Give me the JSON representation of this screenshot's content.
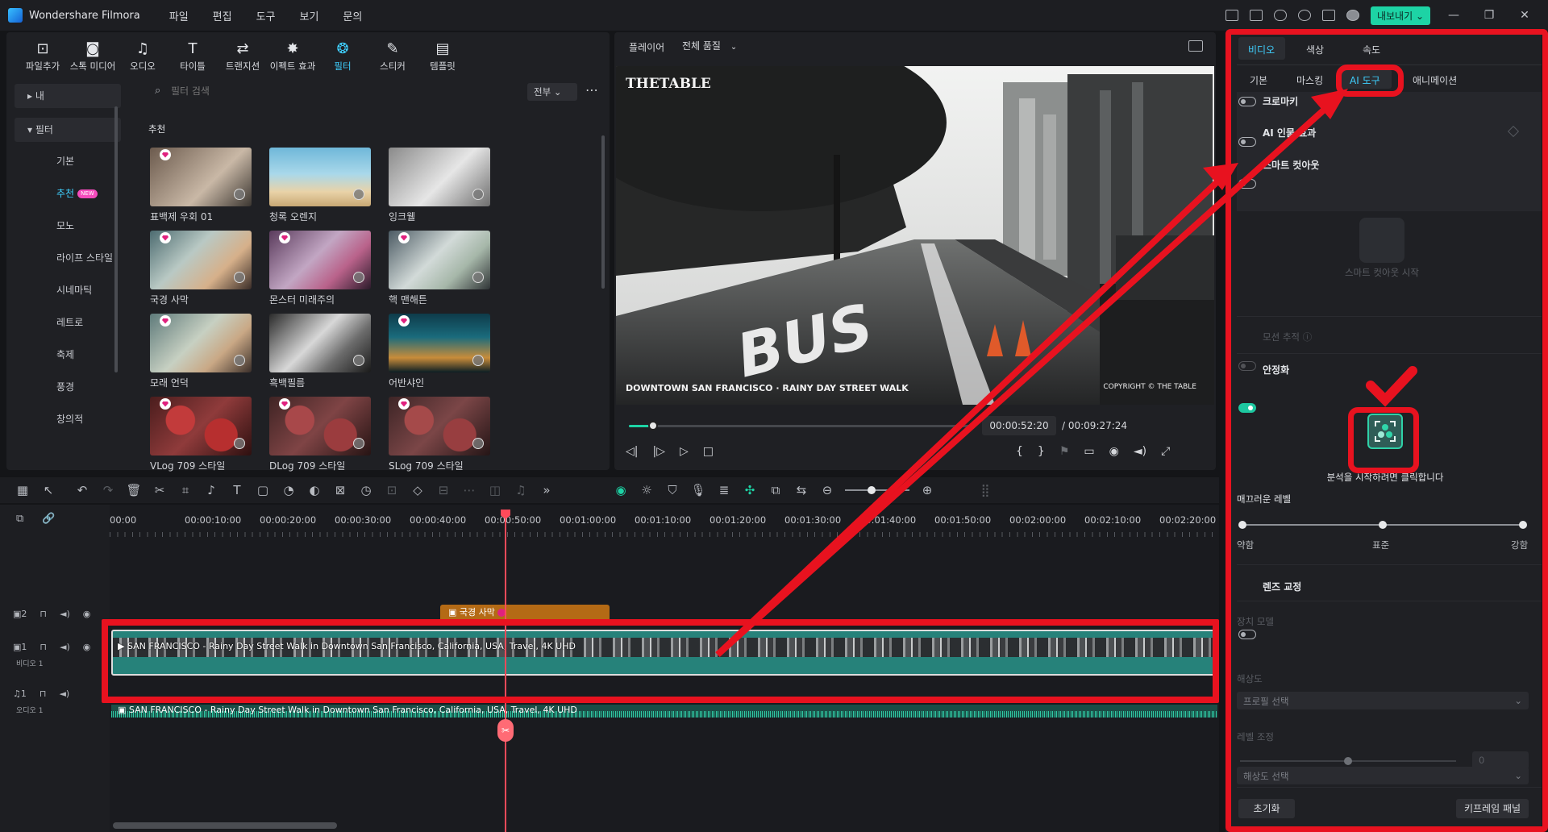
{
  "app": {
    "title": "Wondershare Filmora",
    "menu": [
      "파일",
      "편집",
      "도구",
      "보기",
      "문의"
    ],
    "export": "내보내기"
  },
  "toolbar": {
    "tools": [
      {
        "icon": "import-icon",
        "label": "파일추가",
        "glyph": "⊡"
      },
      {
        "icon": "stock-media-icon",
        "label": "스톡 미디어",
        "glyph": "◙"
      },
      {
        "icon": "audio-icon",
        "label": "오디오",
        "glyph": "♫"
      },
      {
        "icon": "title-icon",
        "label": "타이틀",
        "glyph": "T"
      },
      {
        "icon": "transition-icon",
        "label": "트랜지션",
        "glyph": "⇄"
      },
      {
        "icon": "effects-icon",
        "label": "이펙트 효과",
        "glyph": "✸"
      },
      {
        "icon": "filter-icon",
        "label": "필터",
        "glyph": "❂"
      },
      {
        "icon": "sticker-icon",
        "label": "스티커",
        "glyph": "✎"
      },
      {
        "icon": "template-icon",
        "label": "템플릿",
        "glyph": "▤"
      }
    ]
  },
  "sidebar": {
    "my": "내",
    "filter": "필터",
    "items": [
      "기본",
      "추천",
      "모노",
      "라이프 스타일",
      "시네마틱",
      "레트로",
      "축제",
      "풍경",
      "창의적"
    ],
    "new_badge": "NEW"
  },
  "browser": {
    "search_placeholder": "필터 검색",
    "scope": "전부",
    "section": "추천",
    "thumbs": [
      {
        "label": "표백제 우회 01",
        "premium": true,
        "bg": "linear-gradient(135deg,#6b5a4d,#c9b8a6 60%,#3a3530)"
      },
      {
        "label": "청록 오렌지",
        "premium": false,
        "bg": "linear-gradient(180deg,#6fb7d9 0%,#a9d8ea 45%,#e9d3a8 75%,#c8a874)"
      },
      {
        "label": "잉크웰",
        "premium": false,
        "bg": "linear-gradient(135deg,#8a8a8a,#e6e6e6 55%,#6d6d6d)"
      },
      {
        "label": "국경 사막",
        "premium": true,
        "bg": "linear-gradient(135deg,#4c6b70,#b9c9c4 40%,#d6b08a 70%,#3a2d28)"
      },
      {
        "label": "몬스터 미래주의",
        "premium": true,
        "bg": "linear-gradient(135deg,#5a3b5c,#c2a6c3 45%,#b9628a 70%,#2c1b2b)"
      },
      {
        "label": "핵 맨해튼",
        "premium": true,
        "bg": "linear-gradient(135deg,#4b5a63,#d2dad8 45%,#a6b7a9 70%,#2f3436)"
      },
      {
        "label": "모래 언덕",
        "premium": true,
        "bg": "linear-gradient(135deg,#5e7a7a,#c7d0c2 45%,#c9a885 70%,#3b2f2a)"
      },
      {
        "label": "흑백필름",
        "premium": false,
        "bg": "linear-gradient(135deg,#2a2a2a,#d8d8d8 45%,#6b6b6b 70%,#1a1a1a)"
      },
      {
        "label": "어반샤인",
        "premium": true,
        "bg": "linear-gradient(180deg,#0e3b4a,#1a6b7c 40%,#c88c3a 75%,#0a1d24)"
      },
      {
        "label": "VLog 709 스타일",
        "premium": true,
        "bg": "radial-gradient(circle at 30% 40%,#c23b3b 0 18%,transparent 19%),radial-gradient(circle at 70% 65%,#b72f2f 0 20%,transparent 21%),linear-gradient(135deg,#4a1d1d,#8f3b3b 50%,#2d1010)"
      },
      {
        "label": "DLog 709 스타일",
        "premium": true,
        "bg": "radial-gradient(circle at 30% 40%,#a8484a 0 18%,transparent 19%),radial-gradient(circle at 70% 65%,#9b3c3e 0 20%,transparent 21%),linear-gradient(135deg,#3f2424,#7f4445 50%,#261414)"
      },
      {
        "label": "SLog 709 스타일",
        "premium": true,
        "bg": "radial-gradient(circle at 30% 40%,#a54a4a 0 18%,transparent 19%),radial-gradient(circle at 70% 65%,#983e40 0 20%,transparent 21%),linear-gradient(135deg,#3d2526,#7b4647 50%,#241516)"
      }
    ]
  },
  "player": {
    "label": "플레이어",
    "quality": "전체 품질",
    "overlay_brand": "THETABLE",
    "caption": "DOWNTOWN SAN FRANCISCO · RAINY DAY STREET WALK",
    "copyright": "COPYRIGHT © THE TABLE",
    "current_time": "00:00:52:20",
    "total_time": "/ 00:09:27:24",
    "progress": 0.07
  },
  "right_panel": {
    "tabs": [
      "비디오",
      "색상",
      "속도"
    ],
    "subtabs": [
      "기본",
      "마스킹",
      "AI 도구",
      "애니메이션"
    ],
    "rows": [
      {
        "label": "크로마키",
        "on": false
      },
      {
        "label": "AI 인물 효과",
        "on": false
      },
      {
        "label": "스마트 컷아웃",
        "on": false
      }
    ],
    "cutout_start": "스마트 컷아웃 시작",
    "motion_track": "모션 추적",
    "stabilize": "안정화",
    "analyze_hint": "분석을 시작하려면 클릭합니다",
    "smooth_level": "매끄러운 레벨",
    "levels": [
      "약함",
      "표준",
      "강함"
    ],
    "smooth_value": 0.5,
    "lens": "렌즈 교정",
    "device_model": "장치 모델",
    "profile_select": "프로필 선택",
    "resolution": "해상도",
    "resolution_select": "해상도 선택",
    "level_adjust": "레벨 조정",
    "level_value": "0",
    "level_adjust_value": 0.5,
    "reset": "초기화",
    "keyframe": "키프레임 패널"
  },
  "timeline": {
    "ticks": [
      "00:00",
      "00:00:10:00",
      "00:00:20:00",
      "00:00:30:00",
      "00:00:40:00",
      "00:00:50:00",
      "00:01:00:00",
      "00:01:10:00",
      "00:01:20:00",
      "00:01:30:00",
      "00:01:40:00",
      "00:01:50:00",
      "00:02:00:00",
      "00:02:10:00",
      "00:02:20:00"
    ],
    "filter_clip": "국경 사막",
    "video_clip": "SAN FRANCISCO - Rainy Day Street Walk in Downtown San Francisco, California, USA, Travel, 4K UHD",
    "audio_clip": "SAN FRANCISCO - Rainy Day Street Walk in Downtown San Francisco, California, USA, Travel, 4K UHD",
    "tracks": [
      {
        "num": "2",
        "name": ""
      },
      {
        "num": "1",
        "name": "비디오 1"
      },
      {
        "num": "1",
        "name": "오디오 1"
      }
    ]
  }
}
